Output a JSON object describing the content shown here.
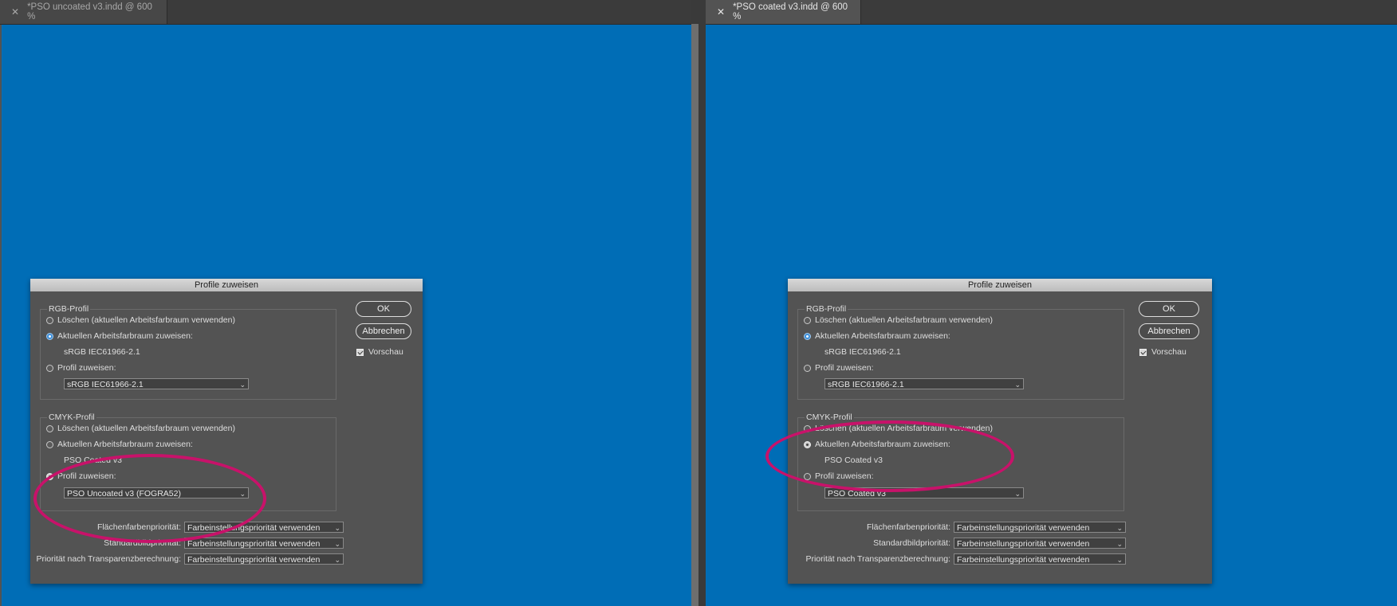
{
  "left": {
    "tab_title": "*PSO uncoated v3.indd @ 600 %",
    "dialog": {
      "title": "Profile zuweisen",
      "rgb": {
        "legend": "RGB-Profil",
        "opt_delete": "Löschen (aktuellen Arbeitsfarbraum verwenden)",
        "opt_current": "Aktuellen Arbeitsfarbraum zuweisen:",
        "current_value": "sRGB IEC61966-2.1",
        "opt_assign": "Profil zuweisen:",
        "select_value": "sRGB IEC61966-2.1",
        "selected": "current"
      },
      "cmyk": {
        "legend": "CMYK-Profil",
        "opt_delete": "Löschen (aktuellen Arbeitsfarbraum verwenden)",
        "opt_current": "Aktuellen Arbeitsfarbraum zuweisen:",
        "current_value": "PSO Coated v3",
        "opt_assign": "Profil zuweisen:",
        "select_value": "PSO Uncoated v3 (FOGRA52)",
        "selected": "assign"
      },
      "priorities": [
        {
          "label": "Flächenfarbenpriorität:",
          "value": "Farbeinstellungspriorität verwenden"
        },
        {
          "label": "Standardbildpriorität:",
          "value": "Farbeinstellungspriorität verwenden"
        },
        {
          "label": "Priorität nach Transparenzberechnung:",
          "value": "Farbeinstellungspriorität verwenden"
        }
      ],
      "ok": "OK",
      "cancel": "Abbrechen",
      "preview": "Vorschau"
    }
  },
  "right": {
    "tab_title": "*PSO coated v3.indd @ 600 %",
    "dialog": {
      "title": "Profile zuweisen",
      "rgb": {
        "legend": "RGB-Profil",
        "opt_delete": "Löschen (aktuellen Arbeitsfarbraum verwenden)",
        "opt_current": "Aktuellen Arbeitsfarbraum zuweisen:",
        "current_value": "sRGB IEC61966-2.1",
        "opt_assign": "Profil zuweisen:",
        "select_value": "sRGB IEC61966-2.1",
        "selected": "current"
      },
      "cmyk": {
        "legend": "CMYK-Profil",
        "opt_delete": "Löschen (aktuellen Arbeitsfarbraum verwenden)",
        "opt_current": "Aktuellen Arbeitsfarbraum zuweisen:",
        "current_value": "PSO Coated v3",
        "opt_assign": "Profil zuweisen:",
        "select_value": "PSO Coated v3",
        "selected": "current"
      },
      "priorities": [
        {
          "label": "Flächenfarbenpriorität:",
          "value": "Farbeinstellungspriorität verwenden"
        },
        {
          "label": "Standardbildpriorität:",
          "value": "Farbeinstellungspriorität verwenden"
        },
        {
          "label": "Priorität nach Transparenzberechnung:",
          "value": "Farbeinstellungspriorität verwenden"
        }
      ],
      "ok": "OK",
      "cancel": "Abbrechen",
      "preview": "Vorschau"
    }
  },
  "colors": {
    "canvas": "#006db6",
    "highlight": "#c8126a",
    "radio_selected": "#3f8fd8"
  },
  "icons": {
    "tab_close": "close-icon",
    "select_arrow": "chevron-down-icon",
    "preview_check": "checkbox-checked-icon"
  }
}
